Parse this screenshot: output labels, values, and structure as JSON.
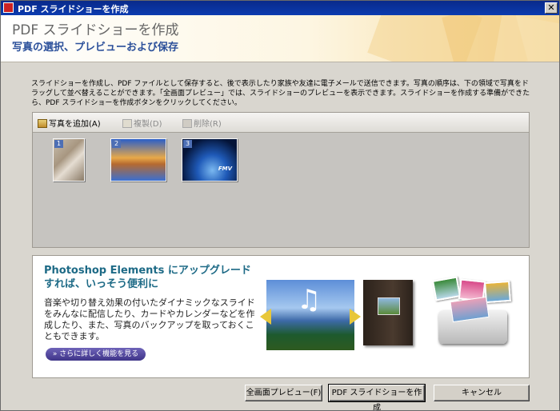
{
  "window": {
    "title": "PDF スライドショーを作成",
    "close_glyph": "✕"
  },
  "header": {
    "title": "PDF スライドショーを作成",
    "subtitle": "写真の選択、プレビューおよび保存"
  },
  "description": "スライドショーを作成し、PDF ファイルとして保存すると、後で表示したり家族や友達に電子メールで送信できます。写真の順序は、下の領域で写真をドラッグして並べ替えることができます。「全画面プレビュー」では、スライドショーのプレビューを表示できます。スライドショーを作成する準備ができたら、PDF スライドショーを作成ボタンをクリックしてください。",
  "toolbar": {
    "add_label": "写真を追加(A)",
    "duplicate_label": "複製(D)",
    "delete_label": "削除(R)"
  },
  "photos": [
    {
      "num": "1"
    },
    {
      "num": "2"
    },
    {
      "num": "3",
      "caption": "FMV"
    }
  ],
  "promo": {
    "title": "Photoshop Elements にアップグレードすれば、いっそう便利に",
    "body": "音楽や切り替え効果の付いたダイナミックなスライドをみんなに配信したり、カードやカレンダーなどを作成したり、また、写真のバックアップを取っておくこともできます。",
    "more_button": "» さらに詳しく機能を見る",
    "music_glyph": "♫"
  },
  "buttons": {
    "preview": "全画面プレビュー(F)",
    "create": "PDF スライドショーを作成",
    "cancel": "キャンセル"
  }
}
